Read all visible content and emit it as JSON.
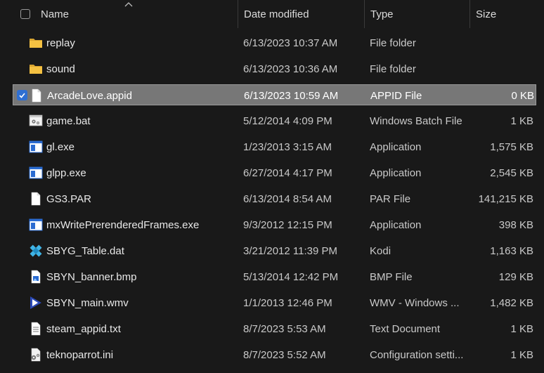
{
  "header": {
    "name_label": "Name",
    "date_label": "Date modified",
    "type_label": "Type",
    "size_label": "Size"
  },
  "files": [
    {
      "name": "replay",
      "date": "6/13/2023 10:37 AM",
      "type": "File folder",
      "size": "",
      "icon": "folder-icon",
      "selected": false
    },
    {
      "name": "sound",
      "date": "6/13/2023 10:36 AM",
      "type": "File folder",
      "size": "",
      "icon": "folder-icon",
      "selected": false
    },
    {
      "name": "ArcadeLove.appid",
      "date": "6/13/2023 10:59 AM",
      "type": "APPID File",
      "size": "0 KB",
      "icon": "blank-file-icon",
      "selected": true
    },
    {
      "name": "game.bat",
      "date": "5/12/2014 4:09 PM",
      "type": "Windows Batch File",
      "size": "1 KB",
      "icon": "batch-file-icon",
      "selected": false
    },
    {
      "name": "gl.exe",
      "date": "1/23/2013 3:15 AM",
      "type": "Application",
      "size": "1,575 KB",
      "icon": "application-icon",
      "selected": false
    },
    {
      "name": "glpp.exe",
      "date": "6/27/2014 4:17 PM",
      "type": "Application",
      "size": "2,545 KB",
      "icon": "application-icon",
      "selected": false
    },
    {
      "name": "GS3.PAR",
      "date": "6/13/2014 8:54 AM",
      "type": "PAR File",
      "size": "141,215 KB",
      "icon": "blank-file-icon",
      "selected": false
    },
    {
      "name": "mxWritePrerenderedFrames.exe",
      "date": "9/3/2012 12:15 PM",
      "type": "Application",
      "size": "398 KB",
      "icon": "application-icon",
      "selected": false
    },
    {
      "name": "SBYG_Table.dat",
      "date": "3/21/2012 11:39 PM",
      "type": "Kodi",
      "size": "1,163 KB",
      "icon": "kodi-icon",
      "selected": false
    },
    {
      "name": "SBYN_banner.bmp",
      "date": "5/13/2014 12:42 PM",
      "type": "BMP File",
      "size": "129 KB",
      "icon": "image-file-icon",
      "selected": false
    },
    {
      "name": "SBYN_main.wmv",
      "date": "1/1/2013 12:46 PM",
      "type": "WMV - Windows ...",
      "size": "1,482 KB",
      "icon": "media-file-icon",
      "selected": false
    },
    {
      "name": "steam_appid.txt",
      "date": "8/7/2023 5:53 AM",
      "type": "Text Document",
      "size": "1 KB",
      "icon": "text-file-icon",
      "selected": false
    },
    {
      "name": "teknoparrot.ini",
      "date": "8/7/2023 5:52 AM",
      "type": "Configuration setti...",
      "size": "1 KB",
      "icon": "config-file-icon",
      "selected": false
    }
  ],
  "colors": {
    "background": "#191919",
    "selection": "#777777",
    "checkbox_accent": "#2f6fd2",
    "folder": "#f4c142"
  }
}
